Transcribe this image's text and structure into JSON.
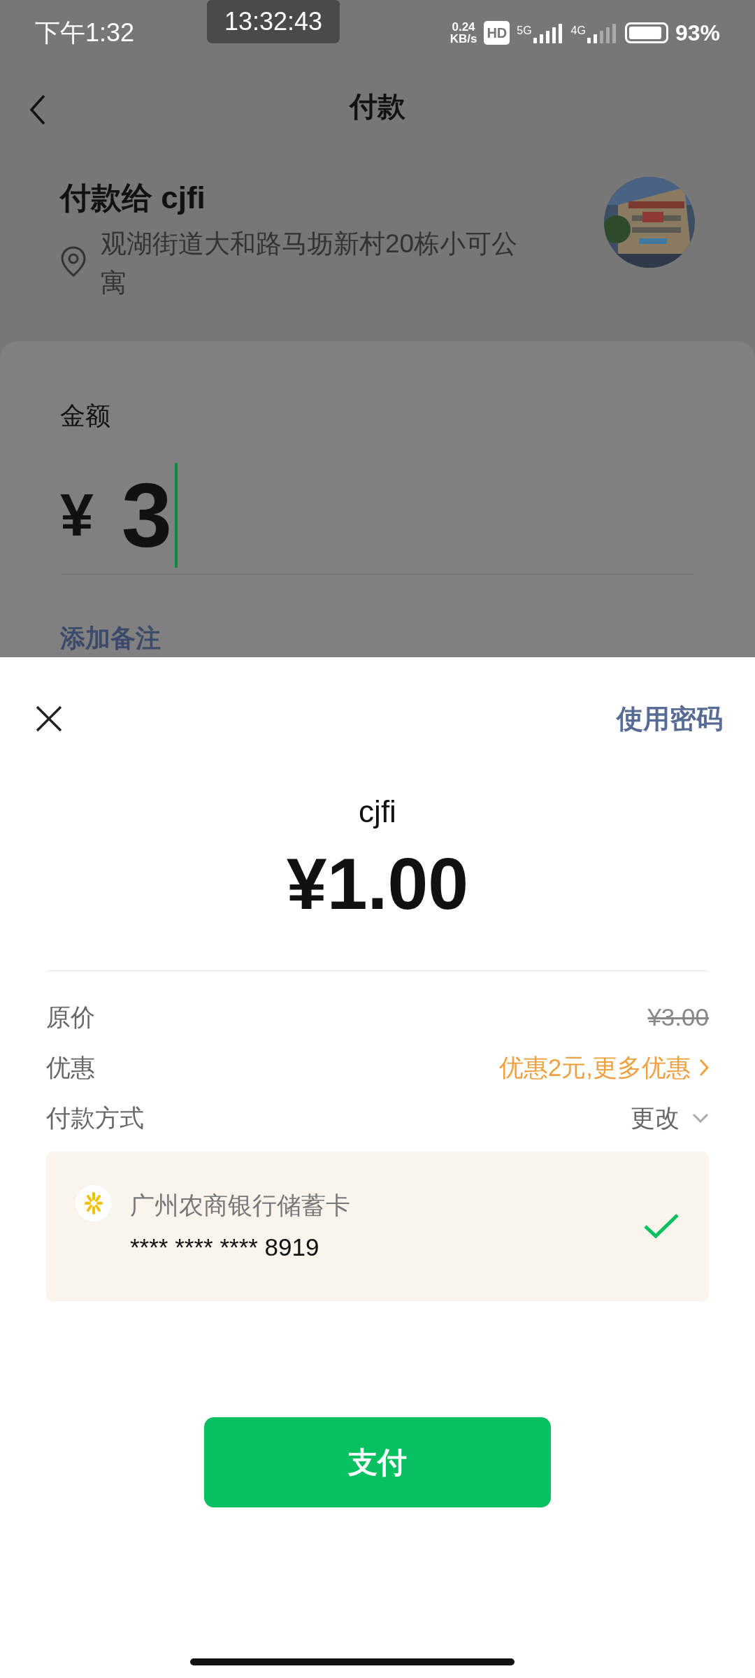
{
  "status_bar": {
    "time": "下午1:32",
    "clock_overlay": "13:32:43",
    "network_speed": "0.24\nKB/s",
    "hd_badge": "HD",
    "signal_1": "5G",
    "signal_2": "4G",
    "battery": "93%"
  },
  "header": {
    "title": "付款"
  },
  "payee": {
    "title": "付款给 cjfi",
    "address": "观湖街道大和路马坜新村20栋小可公寓"
  },
  "amount_form": {
    "label": "金额",
    "currency": "¥",
    "value": "3",
    "remark_link": "添加备注"
  },
  "sheet": {
    "password_link": "使用密码",
    "payee": "cjfi",
    "amount": "¥1.00",
    "rows": [
      {
        "kind": "strike",
        "label": "原价",
        "value": "¥3.00"
      },
      {
        "kind": "promo",
        "label": "优惠",
        "value": "优惠2元,更多优惠"
      },
      {
        "kind": "dropdown",
        "label": "付款方式",
        "value": "更改"
      }
    ],
    "card": {
      "name": "广州农商银行储蓄卡",
      "number": "**** **** **** 8919",
      "selected": true
    },
    "pay_button": "支付"
  }
}
